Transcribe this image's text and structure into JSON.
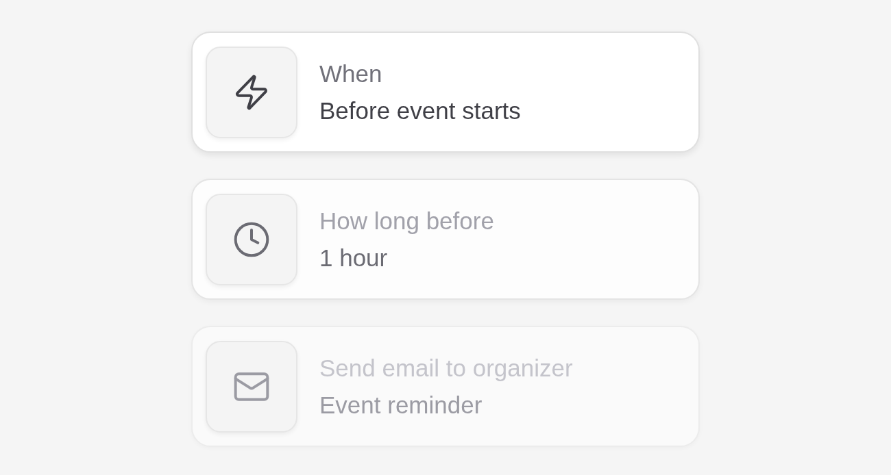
{
  "steps": [
    {
      "kind": "trigger",
      "selected": true,
      "disabled": false,
      "label": "When",
      "value": "Before event starts"
    },
    {
      "kind": "delay",
      "selected": false,
      "disabled": false,
      "label": "How long before",
      "value": "1 hour"
    },
    {
      "kind": "email",
      "selected": false,
      "disabled": true,
      "label": "Send email to organizer",
      "value": "Event reminder"
    }
  ]
}
